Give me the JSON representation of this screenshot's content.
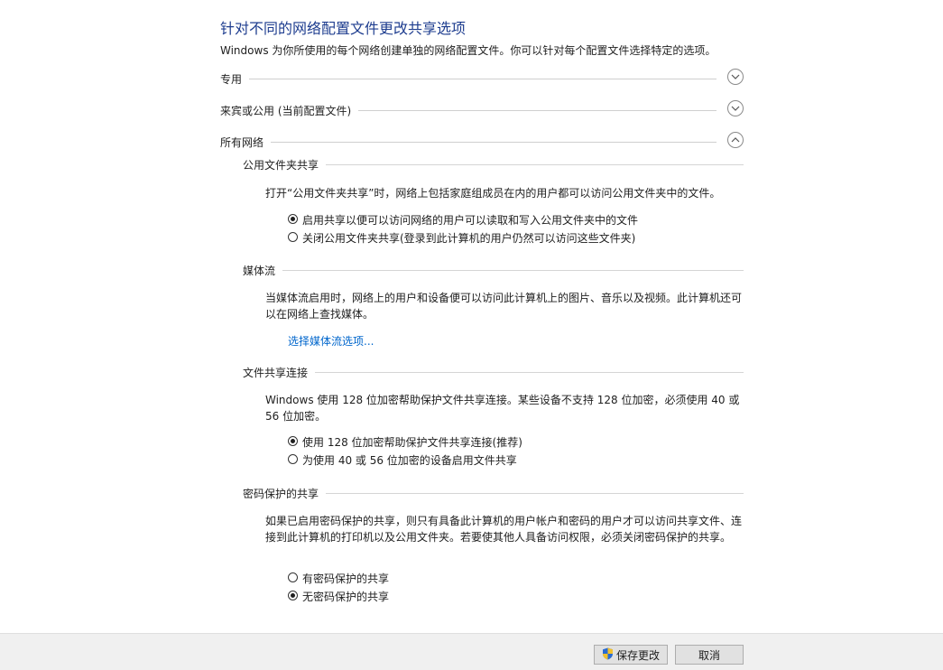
{
  "header": {
    "title": "针对不同的网络配置文件更改共享选项",
    "description": "Windows 为你所使用的每个网络创建单独的网络配置文件。你可以针对每个配置文件选择特定的选项。"
  },
  "profiles": [
    {
      "label": "专用",
      "expanded": false
    },
    {
      "label": "来宾或公用 (当前配置文件)",
      "expanded": false
    },
    {
      "label": "所有网络",
      "expanded": true
    }
  ],
  "public_folder": {
    "title": "公用文件夹共享",
    "description": "打开“公用文件夹共享”时，网络上包括家庭组成员在内的用户都可以访问公用文件夹中的文件。",
    "options": [
      {
        "label": "启用共享以便可以访问网络的用户可以读取和写入公用文件夹中的文件",
        "selected": true
      },
      {
        "label": "关闭公用文件夹共享(登录到此计算机的用户仍然可以访问这些文件夹)",
        "selected": false
      }
    ]
  },
  "media": {
    "title": "媒体流",
    "description": "当媒体流启用时，网络上的用户和设备便可以访问此计算机上的图片、音乐以及视频。此计算机还可以在网络上查找媒体。",
    "link": "选择媒体流选项..."
  },
  "file_sharing": {
    "title": "文件共享连接",
    "description": "Windows 使用 128 位加密帮助保护文件共享连接。某些设备不支持 128 位加密，必须使用 40 或 56 位加密。",
    "options": [
      {
        "label": "使用 128 位加密帮助保护文件共享连接(推荐)",
        "selected": true
      },
      {
        "label": "为使用 40 或 56 位加密的设备启用文件共享",
        "selected": false
      }
    ]
  },
  "password": {
    "title": "密码保护的共享",
    "description": "如果已启用密码保护的共享，则只有具备此计算机的用户帐户和密码的用户才可以访问共享文件、连接到此计算机的打印机以及公用文件夹。若要使其他人具备访问权限，必须关闭密码保护的共享。",
    "options": [
      {
        "label": "有密码保护的共享",
        "selected": false
      },
      {
        "label": "无密码保护的共享",
        "selected": true
      }
    ]
  },
  "footer": {
    "save_label": "保存更改",
    "cancel_label": "取消"
  },
  "icons": {
    "chevron_down": "chevron-down-icon",
    "chevron_up": "chevron-up-icon",
    "shield": "uac-shield-icon"
  },
  "colors": {
    "title": "#1e3d8f",
    "link": "#0066cc",
    "footer_bg": "#f0f0f0"
  }
}
